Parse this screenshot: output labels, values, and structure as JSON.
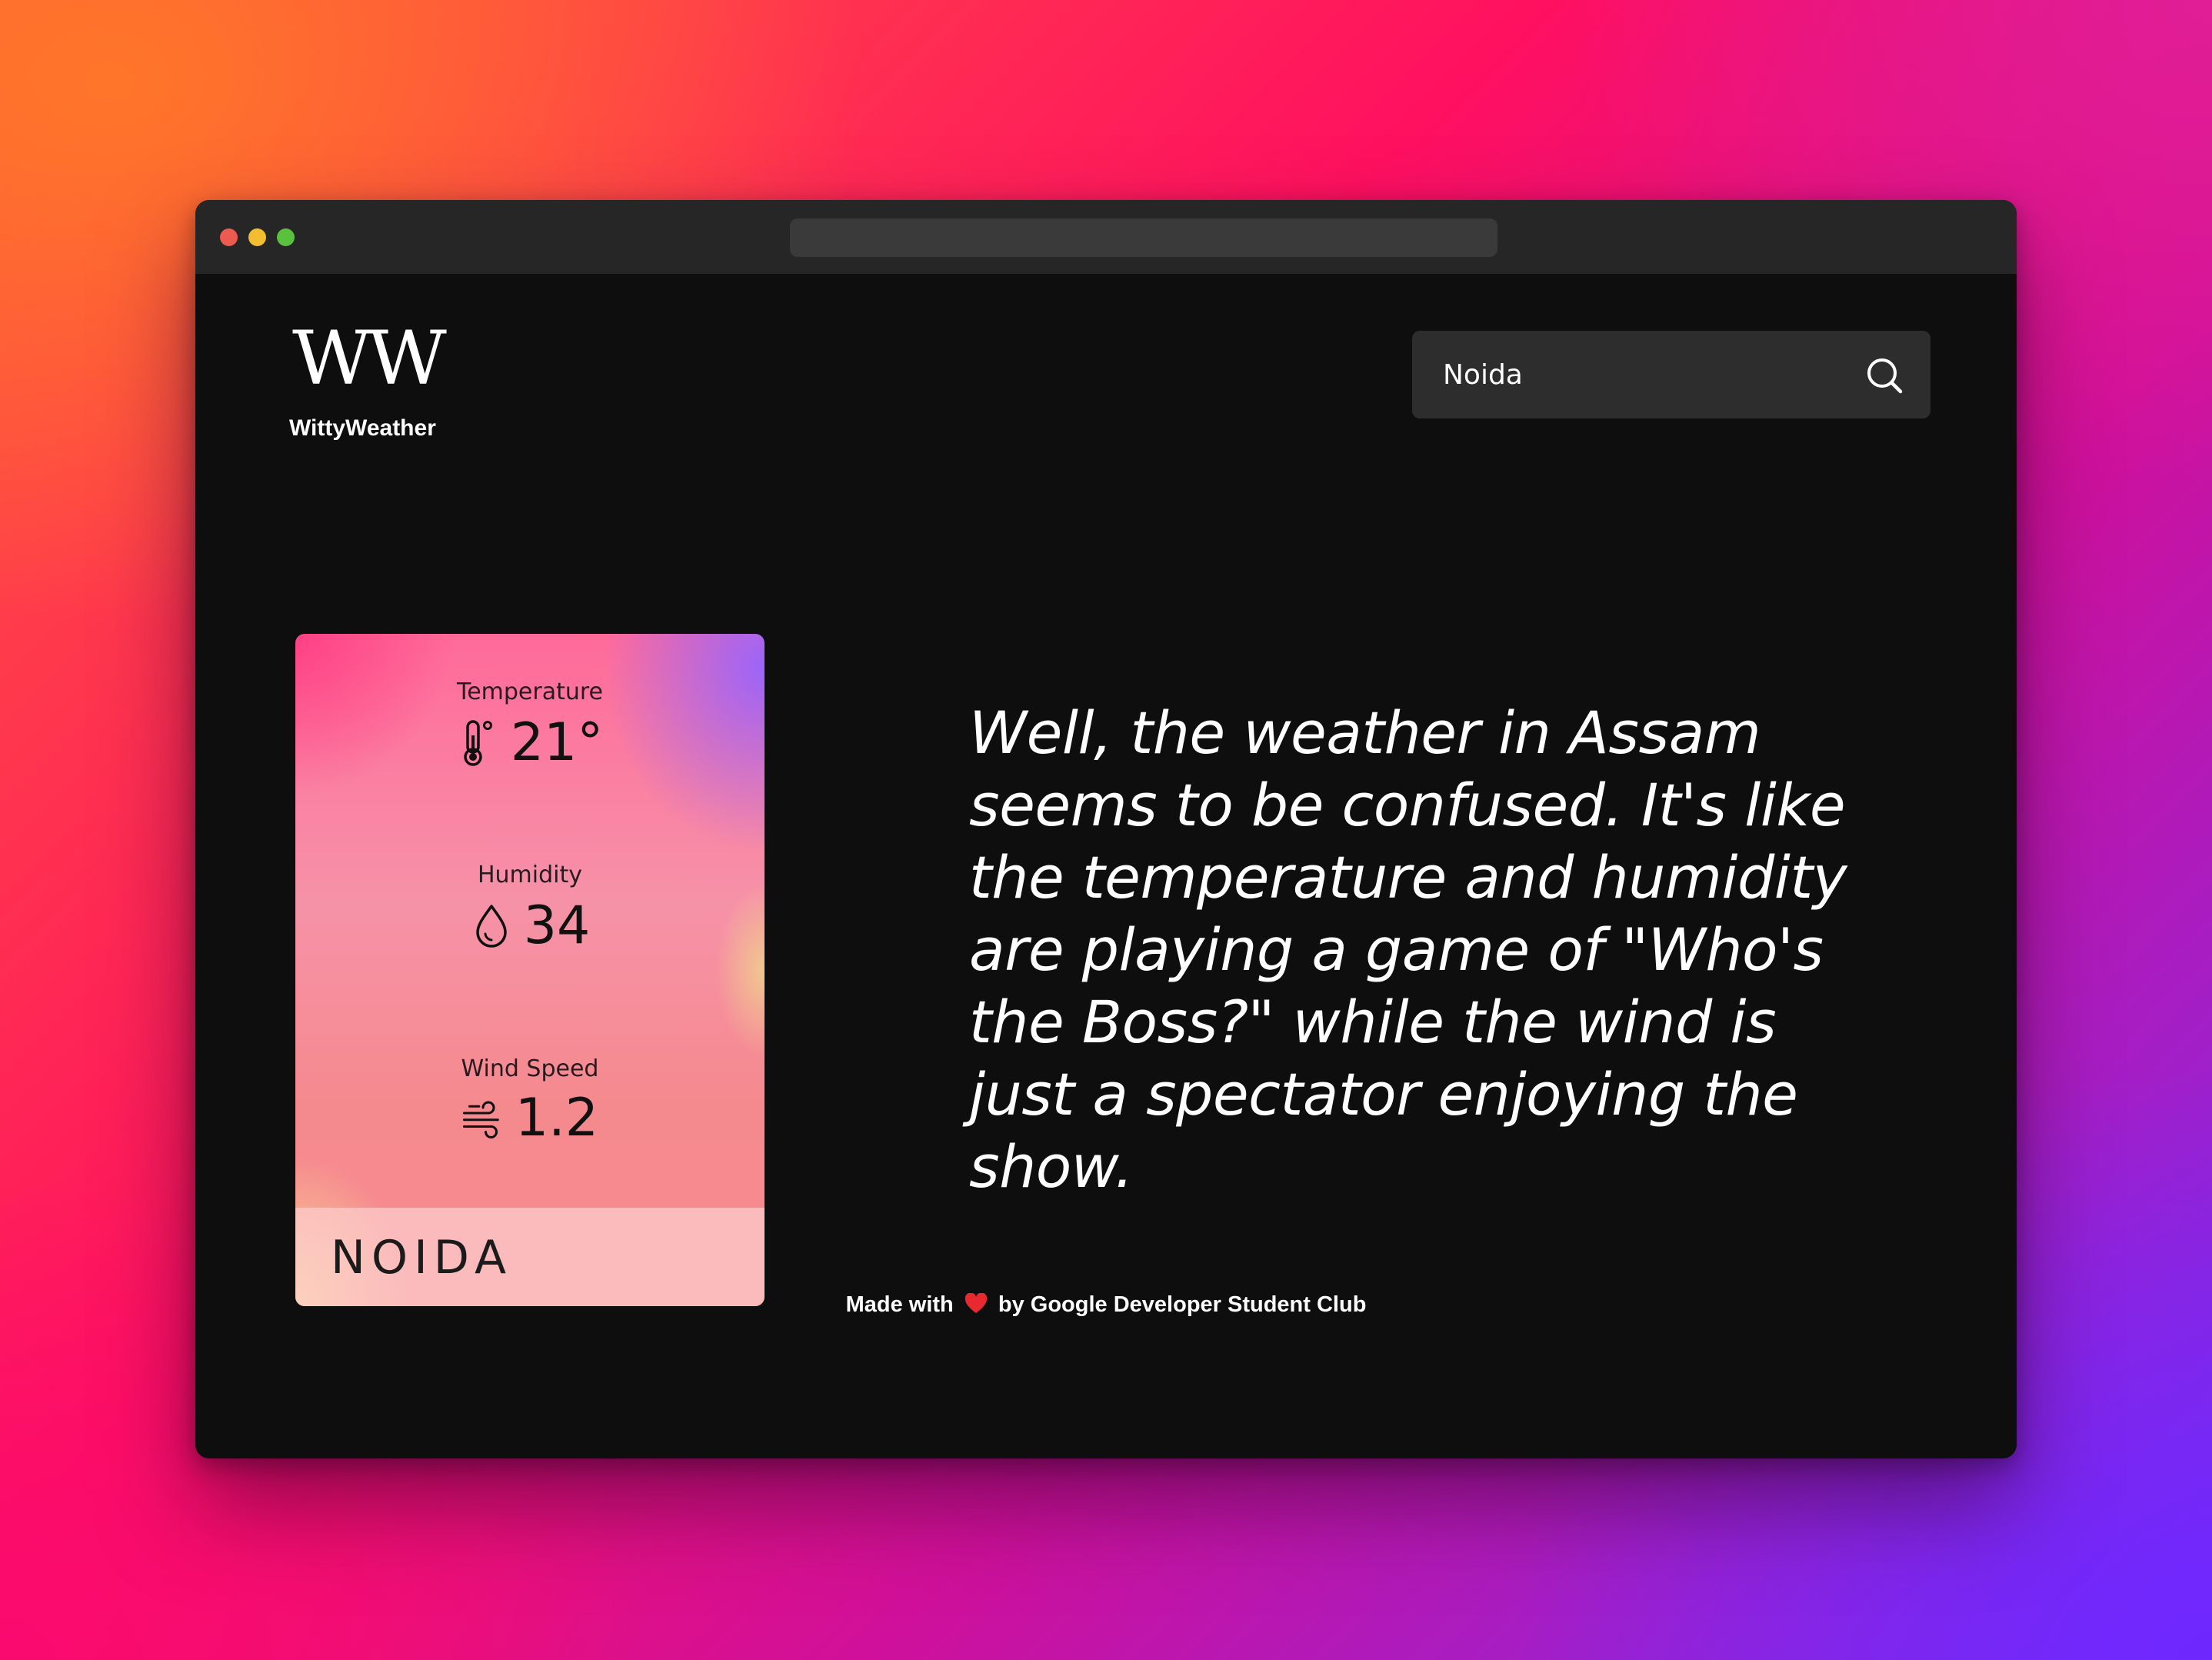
{
  "logo": {
    "mark": "WW",
    "name": "WittyWeather"
  },
  "search": {
    "value": "Noida",
    "icon": "search-icon"
  },
  "card": {
    "temperature": {
      "label": "Temperature",
      "value": "21°",
      "icon": "thermometer-icon"
    },
    "humidity": {
      "label": "Humidity",
      "value": "34",
      "icon": "droplet-icon"
    },
    "wind": {
      "label": "Wind Speed",
      "value": "1.2",
      "icon": "wind-icon"
    },
    "city": "NOIDA"
  },
  "quote": "Well, the weather in Assam seems to be confused. It's like the temperature and humidity are playing a game of \"Who's the Boss?\" while the wind is just a spectator enjoying the show.",
  "footer": {
    "prefix": "Made with",
    "suffix": "by Google Developer Student Club",
    "heart_color": "#e8292f"
  },
  "colors": {
    "window_bg": "#0e0e0e",
    "titlebar": "#262626",
    "search_bg": "#2d2d2d"
  }
}
